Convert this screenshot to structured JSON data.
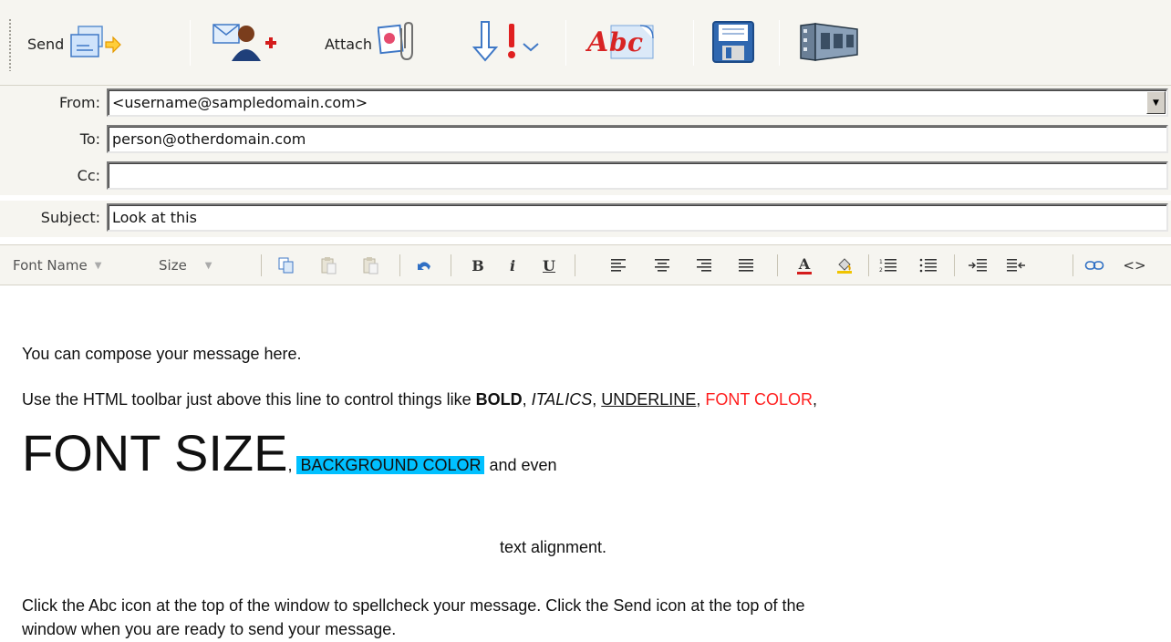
{
  "toolbar": {
    "send_label": "Send",
    "attach_label": "Attach"
  },
  "header": {
    "from_label": "From:",
    "from_value": "<username@sampledomain.com>",
    "to_label": "To:",
    "to_value": "person@otherdomain.com",
    "cc_label": "Cc:",
    "cc_value": "",
    "subject_label": "Subject:",
    "subject_value": "Look at this"
  },
  "format_toolbar": {
    "font_name_placeholder": "Font Name",
    "size_placeholder": "Size",
    "bold_glyph": "B",
    "italic_glyph": "i",
    "underline_glyph": "U",
    "text_color_glyph": "A",
    "source_glyph": "<>"
  },
  "body": {
    "line1": "You can compose your message here.",
    "line2_intro": "Use the HTML toolbar just above this line to control things like ",
    "bold_word": "BOLD",
    "comma": ", ",
    "italics_word": "ITALICS",
    "underline_word": "UNDERLINE",
    "fontcolor_word": "FONT COLOR",
    "trailing_comma": ",",
    "fontsize_word": "FONT SIZE",
    "bgcolor_word": "BACKGROUND COLOR",
    "and_even": " and even",
    "alignment_text": "text alignment.",
    "line4": "Click the Abc icon at the top of the window to spellcheck your message. Click the Send icon at the top of the",
    "line5": "window when you are ready to send your message."
  },
  "colors": {
    "toolbar_bg": "#f6f5f0",
    "font_color_red": "#ff2020",
    "background_highlight": "#00c0ff"
  }
}
